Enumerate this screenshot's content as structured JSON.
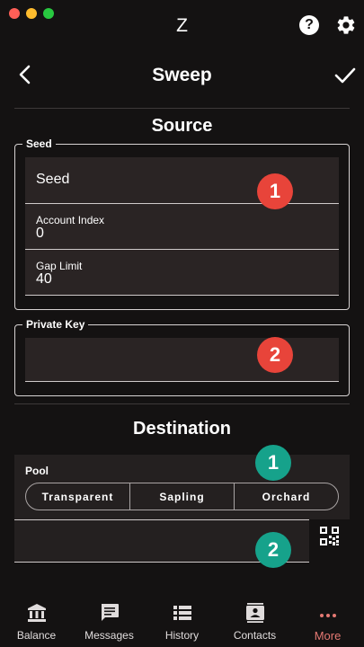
{
  "window": {
    "title": "Z"
  },
  "header": {
    "title": "Sweep"
  },
  "source": {
    "title": "Source",
    "seed_group": {
      "legend": "Seed",
      "seed_placeholder": "Seed",
      "account_index_label": "Account Index",
      "account_index_value": "0",
      "gap_limit_label": "Gap Limit",
      "gap_limit_value": "40"
    },
    "private_key_group": {
      "legend": "Private Key",
      "value": ""
    }
  },
  "destination": {
    "title": "Destination",
    "pool_label": "Pool",
    "pools": [
      "Transparent",
      "Sapling",
      "Orchard"
    ],
    "address_value": ""
  },
  "badges": {
    "red": [
      "1",
      "2"
    ],
    "teal": [
      "1",
      "2"
    ]
  },
  "colors": {
    "background": "#141212",
    "field_background": "#2a2424",
    "badge_red": "#e8443a",
    "badge_teal": "#16a28b",
    "active_nav": "#e57973"
  },
  "bottom_nav": {
    "items": [
      {
        "label": "Balance",
        "icon": "bank-icon"
      },
      {
        "label": "Messages",
        "icon": "message-icon"
      },
      {
        "label": "History",
        "icon": "list-icon"
      },
      {
        "label": "Contacts",
        "icon": "contact-icon"
      },
      {
        "label": "More",
        "icon": "more-icon"
      }
    ],
    "active": "More"
  }
}
